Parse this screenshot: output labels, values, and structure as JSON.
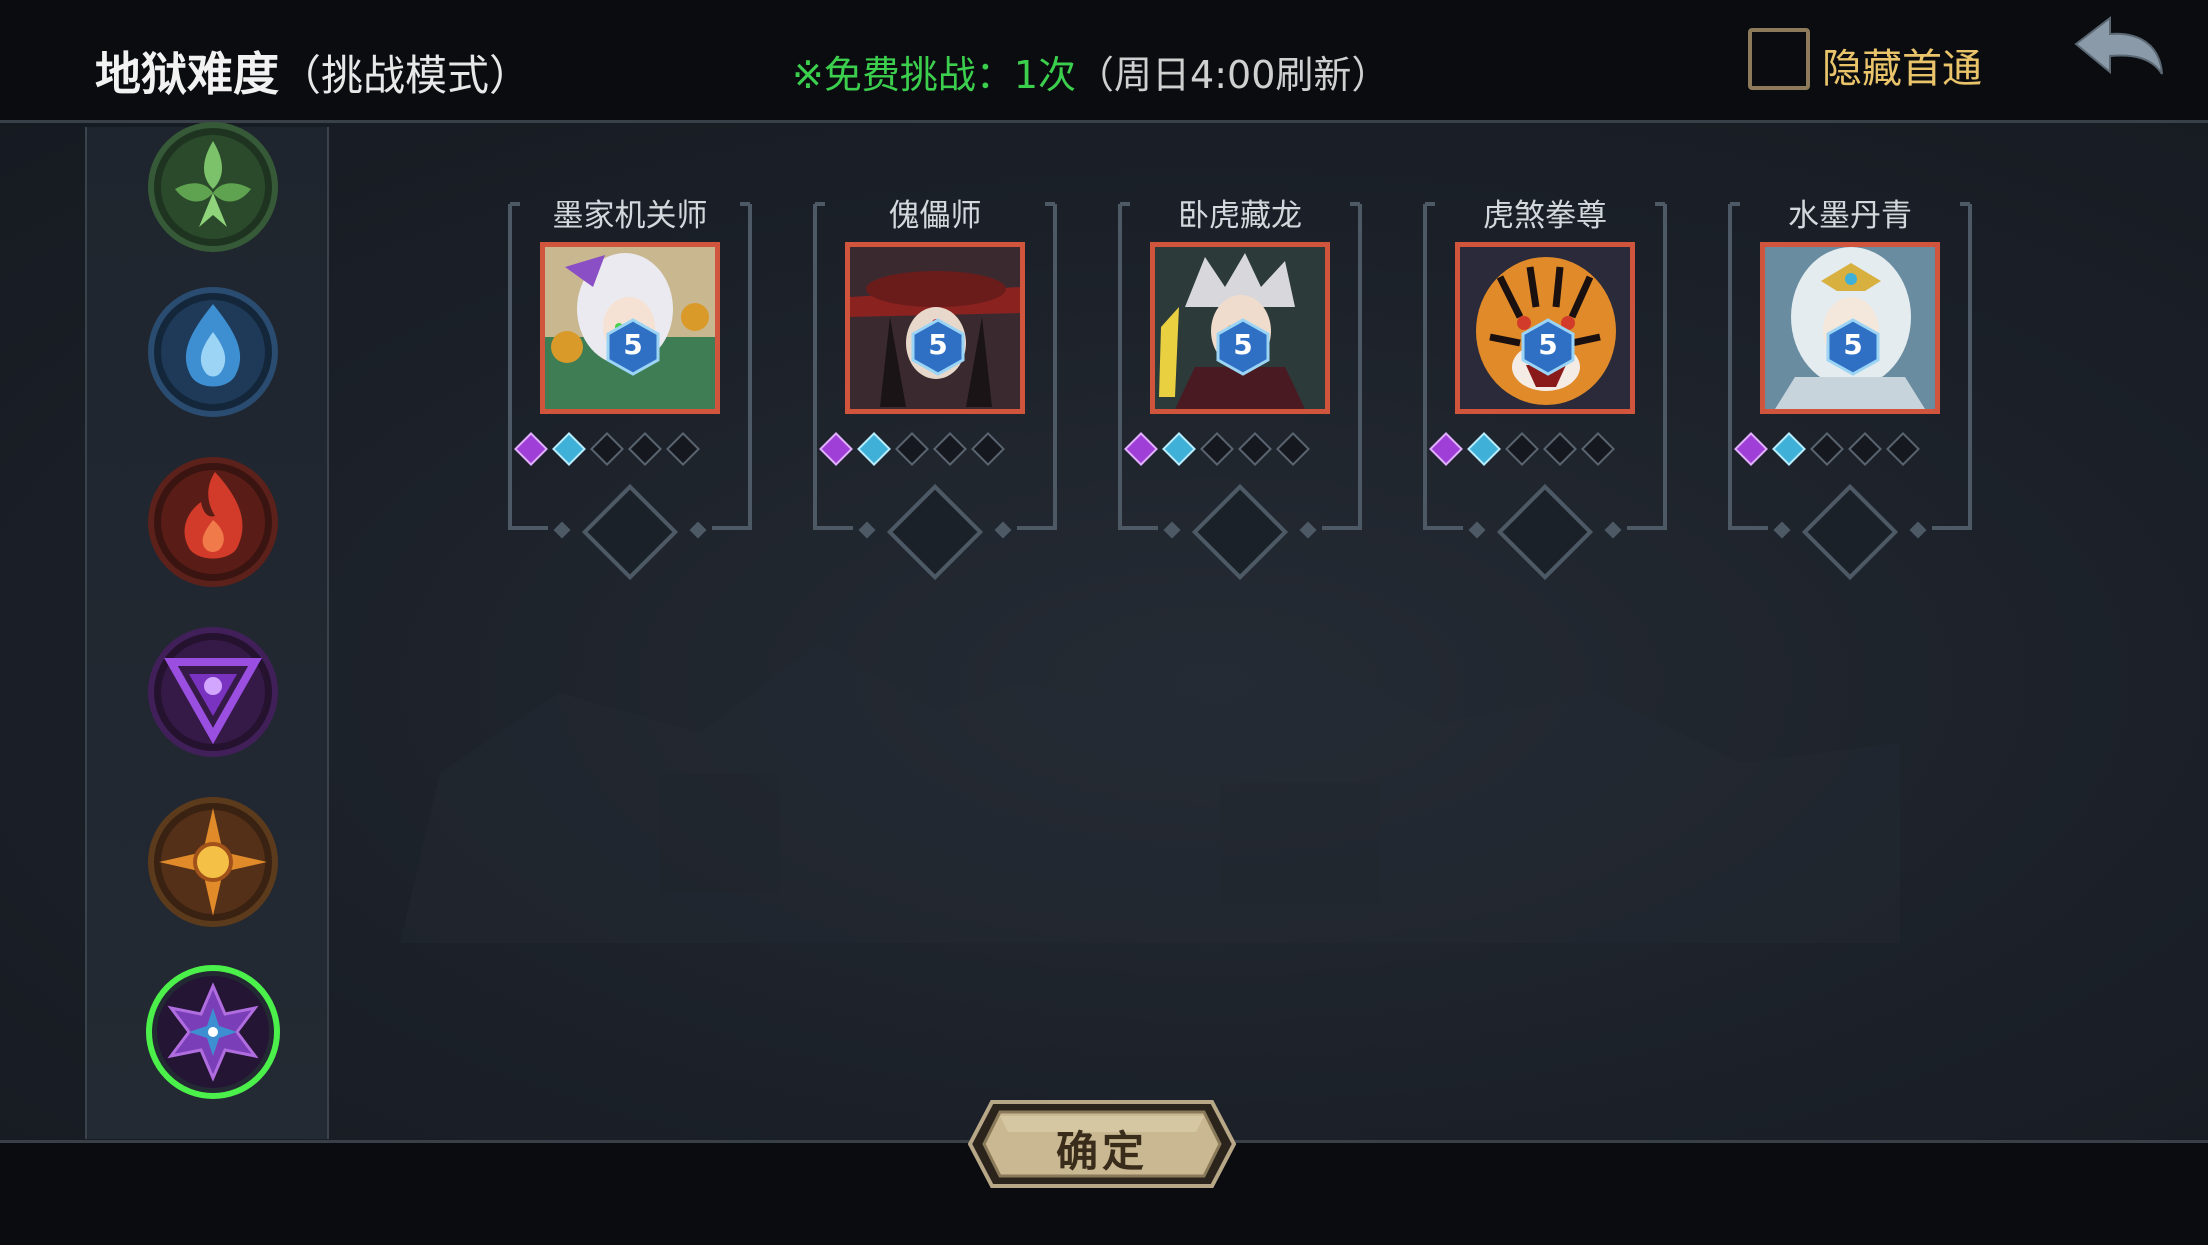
{
  "header": {
    "title": "地狱难度",
    "title_sub": "（挑战模式）",
    "free_label": "※免费挑战：1次",
    "free_refresh": "（周日4:00刷新）",
    "hide_label": "隐藏首通",
    "hide_checked": false
  },
  "sidebar": {
    "factions": [
      {
        "name": "nature-faction-icon",
        "color": "#6aa84f"
      },
      {
        "name": "water-faction-icon",
        "color": "#3d8fd1"
      },
      {
        "name": "fire-faction-icon",
        "color": "#d23b2a"
      },
      {
        "name": "shadow-faction-icon",
        "color": "#8a3ccf"
      },
      {
        "name": "sun-faction-icon",
        "color": "#e08a2a"
      },
      {
        "name": "star-faction-icon",
        "color": "#7a3fb8",
        "selected": true
      }
    ]
  },
  "heroes": [
    {
      "name": "墨家机关师",
      "level": "5"
    },
    {
      "name": "傀儡师",
      "level": "5"
    },
    {
      "name": "卧虎藏龙",
      "level": "5"
    },
    {
      "name": "虎煞拳尊",
      "level": "5"
    },
    {
      "name": "水墨丹青",
      "level": "5"
    }
  ],
  "footer": {
    "confirm_label": "确定"
  },
  "colors": {
    "accent_green": "#3ccf4e",
    "accent_gold": "#e9c46a",
    "portrait_border": "#d1553d"
  }
}
